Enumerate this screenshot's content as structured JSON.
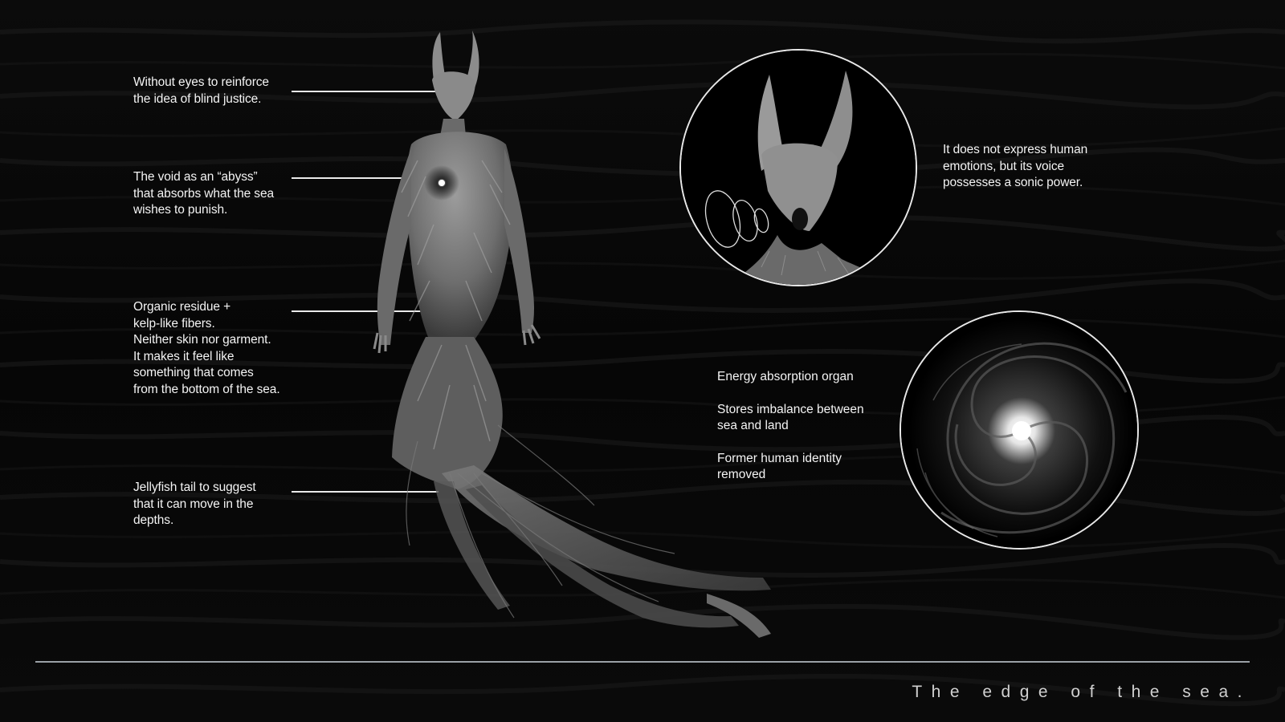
{
  "annotations": {
    "eyes": [
      "Without eyes to reinforce",
      "the idea of blind justice."
    ],
    "void": [
      "The void as an “abyss”",
      "that absorbs what the sea",
      "wishes to punish."
    ],
    "residue": [
      "Organic residue +",
      "kelp-like fibers.",
      "Neither skin nor garment.",
      "It makes it feel like",
      "something that comes",
      "from the bottom of the sea."
    ],
    "tail": [
      "Jellyfish tail to suggest",
      "that it can move in the",
      "depths."
    ]
  },
  "voice_note": [
    "It does not express human",
    "emotions, but its voice",
    "possesses a sonic power."
  ],
  "organ_notes": [
    [
      "Energy absorption organ"
    ],
    [
      "Stores imbalance between",
      "sea and land"
    ],
    [
      "Former human identity",
      "removed"
    ]
  ],
  "footer": {
    "title": "The edge of the sea."
  },
  "colors": {
    "background": "#050505",
    "text": "#f4f4f4",
    "rule": "#9aa0a6",
    "creature": "#8a8a8a"
  },
  "illustrations": {
    "creature": "sea-creature-figure",
    "head_closeup": "creature-head-closeup",
    "vortex_closeup": "abyss-vortex-closeup"
  }
}
